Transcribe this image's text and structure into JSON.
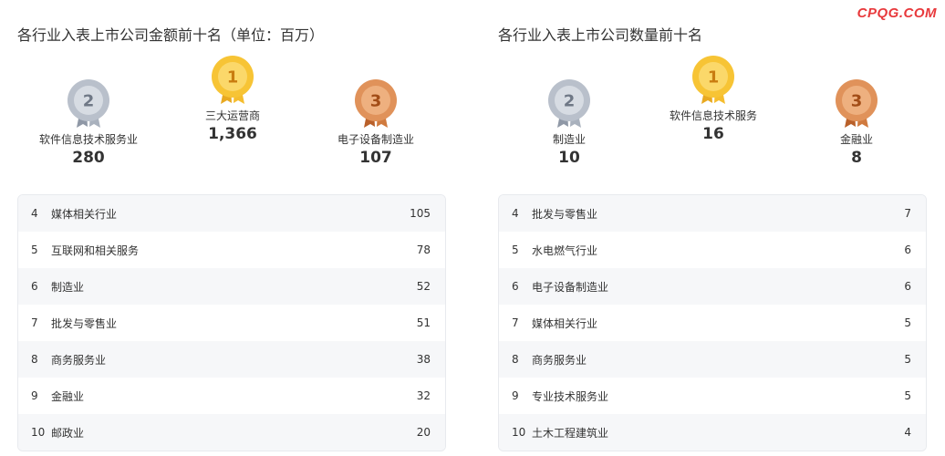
{
  "watermark": "CPQG.COM",
  "colors": {
    "gold": "#f7c435",
    "silver": "#b9c0cb",
    "bronze": "#e0925a",
    "watermark": "#e8393c"
  },
  "left": {
    "title": "各行业入表上市公司金额前十名（单位：百万）",
    "top3": [
      {
        "rank": "1",
        "name": "三大运营商",
        "value": "1,366",
        "medal": "gold-medal"
      },
      {
        "rank": "2",
        "name": "软件信息技术服务业",
        "value": "280",
        "medal": "silver-medal"
      },
      {
        "rank": "3",
        "name": "电子设备制造业",
        "value": "107",
        "medal": "bronze-medal"
      }
    ],
    "rows": [
      {
        "rank": "4",
        "name": "媒体相关行业",
        "value": "105"
      },
      {
        "rank": "5",
        "name": "互联网和相关服务",
        "value": "78"
      },
      {
        "rank": "6",
        "name": "制造业",
        "value": "52"
      },
      {
        "rank": "7",
        "name": "批发与零售业",
        "value": "51"
      },
      {
        "rank": "8",
        "name": "商务服务业",
        "value": "38"
      },
      {
        "rank": "9",
        "name": "金融业",
        "value": "32"
      },
      {
        "rank": "10",
        "name": "邮政业",
        "value": "20"
      }
    ]
  },
  "right": {
    "title": "各行业入表上市公司数量前十名",
    "top3": [
      {
        "rank": "1",
        "name": "软件信息技术服务",
        "value": "16",
        "medal": "gold-medal"
      },
      {
        "rank": "2",
        "name": "制造业",
        "value": "10",
        "medal": "silver-medal"
      },
      {
        "rank": "3",
        "name": "金融业",
        "value": "8",
        "medal": "bronze-medal"
      }
    ],
    "rows": [
      {
        "rank": "4",
        "name": "批发与零售业",
        "value": "7"
      },
      {
        "rank": "5",
        "name": "水电燃气行业",
        "value": "6"
      },
      {
        "rank": "6",
        "name": "电子设备制造业",
        "value": "6"
      },
      {
        "rank": "7",
        "name": "媒体相关行业",
        "value": "5"
      },
      {
        "rank": "8",
        "name": "商务服务业",
        "value": "5"
      },
      {
        "rank": "9",
        "name": "专业技术服务业",
        "value": "5"
      },
      {
        "rank": "10",
        "name": "土木工程建筑业",
        "value": "4"
      }
    ]
  }
}
